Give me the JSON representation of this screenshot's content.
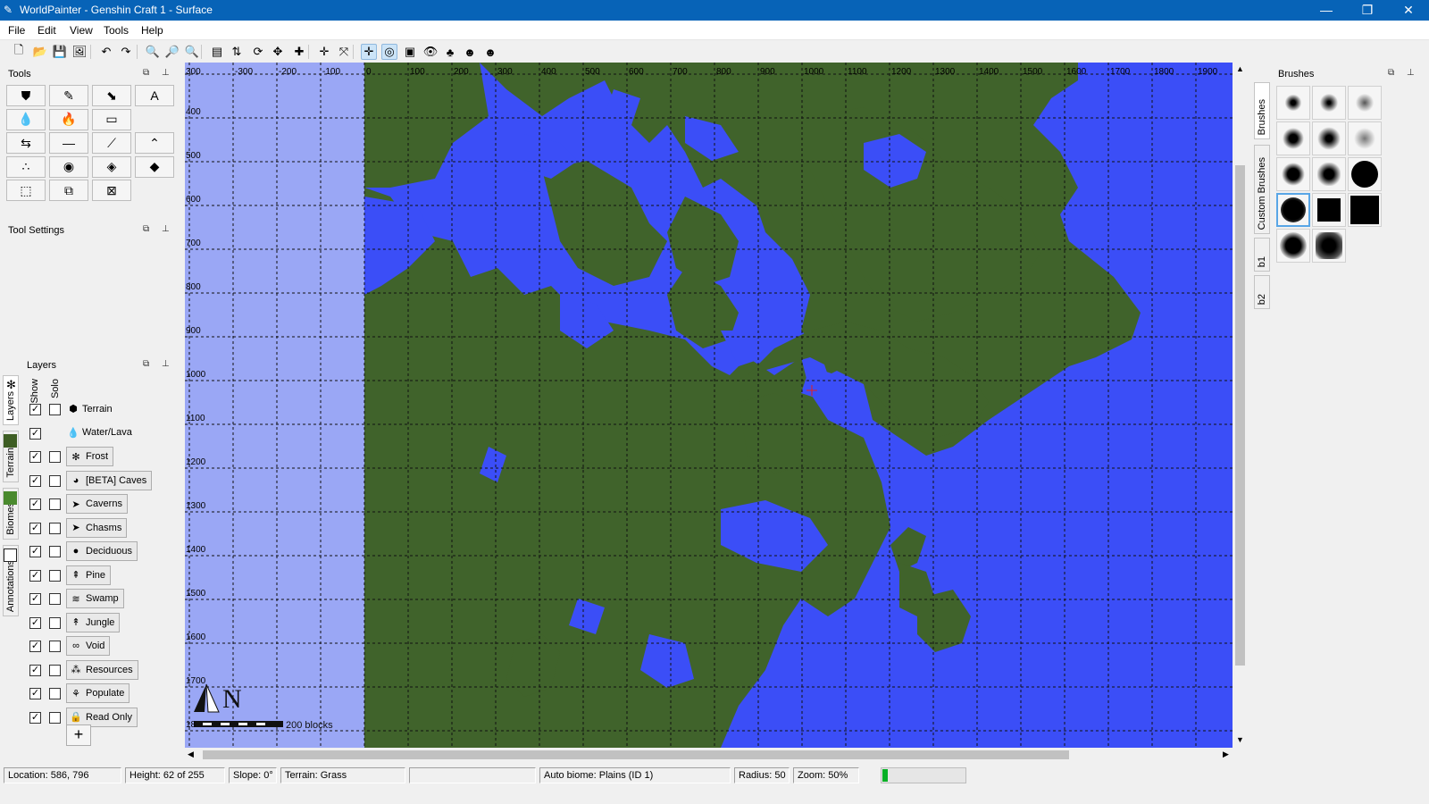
{
  "window": {
    "title": "WorldPainter - Genshin Craft 1 - Surface",
    "min": "—",
    "max": "❐",
    "close": "✕"
  },
  "menu": [
    "File",
    "Edit",
    "View",
    "Tools",
    "Help"
  ],
  "toolbar": [
    {
      "icon": "new-icon",
      "glyph": "🗋"
    },
    {
      "icon": "open-icon",
      "glyph": "📂"
    },
    {
      "icon": "save-icon",
      "glyph": "💾"
    },
    {
      "icon": "export-icon",
      "glyph": "🖼"
    },
    {
      "icon": "undo-icon",
      "glyph": "↶"
    },
    {
      "icon": "redo-icon",
      "glyph": "↷"
    },
    {
      "icon": "zoom-in-icon",
      "glyph": "🔍"
    },
    {
      "icon": "zoom-reset-icon",
      "glyph": "🔎"
    },
    {
      "icon": "zoom-out-icon",
      "glyph": "🔍"
    },
    {
      "icon": "dimension-properties-icon",
      "glyph": "▤"
    },
    {
      "icon": "change-height-icon",
      "glyph": "⇅"
    },
    {
      "icon": "rotate-icon",
      "glyph": "⟳"
    },
    {
      "icon": "shift-icon",
      "glyph": "✥"
    },
    {
      "icon": "add-tiles-icon",
      "glyph": "✚"
    },
    {
      "icon": "remove-tiles-icon",
      "glyph": "✛"
    },
    {
      "icon": "fit-icon",
      "glyph": "⤧"
    },
    {
      "icon": "grid-icon",
      "glyph": "✛"
    },
    {
      "icon": "contours-icon",
      "glyph": "◎"
    },
    {
      "icon": "view-icon",
      "glyph": "▣"
    },
    {
      "icon": "view-3d-icon",
      "glyph": "👁"
    },
    {
      "icon": "biomes-icon",
      "glyph": "♣"
    },
    {
      "icon": "globe-icon",
      "glyph": "☻"
    },
    {
      "icon": "globe-alt-icon",
      "glyph": "☻"
    }
  ],
  "tools_panel": {
    "title": "Tools",
    "tools": [
      {
        "name": "raise-lower-icon",
        "glyph": "⛊"
      },
      {
        "name": "pencil-icon",
        "glyph": "✎"
      },
      {
        "name": "flood-icon",
        "glyph": "⬊"
      },
      {
        "name": "text-icon",
        "glyph": "A"
      },
      {
        "name": "water-icon",
        "glyph": "💧"
      },
      {
        "name": "lava-icon",
        "glyph": "🔥"
      },
      {
        "name": "sponge-icon",
        "glyph": "▭"
      },
      {
        "name": "smooth-icon",
        "glyph": "⇆"
      },
      {
        "name": "flatten-icon",
        "glyph": "—"
      },
      {
        "name": "slope-icon",
        "glyph": "⟋"
      },
      {
        "name": "mountain-icon",
        "glyph": "⌃"
      },
      {
        "name": "spray-icon",
        "glyph": "∴"
      },
      {
        "name": "globe-tool-icon",
        "glyph": "◉"
      },
      {
        "name": "raise-pyramid-icon",
        "glyph": "◈"
      },
      {
        "name": "raise-rotated-pyramid-icon",
        "glyph": "◆"
      },
      {
        "name": "select-icon",
        "glyph": "⬚"
      },
      {
        "name": "copy-selection-icon",
        "glyph": "⧉"
      },
      {
        "name": "clear-selection-icon",
        "glyph": "⊠"
      }
    ]
  },
  "tool_settings": {
    "title": "Tool Settings"
  },
  "layers_panel": {
    "title": "Layers",
    "col_show": "Show",
    "col_solo": "Solo",
    "layers": [
      {
        "label": "Terrain",
        "icon": "terrain-icon",
        "glyph": "⬢",
        "show": true,
        "solo": false,
        "plain": true
      },
      {
        "label": "Water/Lava",
        "icon": "water-lava-icon",
        "glyph": "💧",
        "show": true,
        "solo": null,
        "plain": true
      },
      {
        "label": "Frost",
        "icon": "frost-icon",
        "glyph": "✻",
        "show": true,
        "solo": false
      },
      {
        "label": "[BETA] Caves",
        "icon": "caves-icon",
        "glyph": "◕",
        "show": true,
        "solo": false
      },
      {
        "label": "Caverns",
        "icon": "caverns-icon",
        "glyph": "➤",
        "show": true,
        "solo": false
      },
      {
        "label": "Chasms",
        "icon": "chasms-icon",
        "glyph": "➤",
        "show": true,
        "solo": false
      },
      {
        "label": "Deciduous",
        "icon": "deciduous-icon",
        "glyph": "●",
        "show": true,
        "solo": false
      },
      {
        "label": "Pine",
        "icon": "pine-icon",
        "glyph": "⇞",
        "show": true,
        "solo": false
      },
      {
        "label": "Swamp",
        "icon": "swamp-icon",
        "glyph": "≋",
        "show": true,
        "solo": false
      },
      {
        "label": "Jungle",
        "icon": "jungle-icon",
        "glyph": "↟",
        "show": true,
        "solo": false
      },
      {
        "label": "Void",
        "icon": "void-icon",
        "glyph": "∞",
        "show": true,
        "solo": false
      },
      {
        "label": "Resources",
        "icon": "resources-icon",
        "glyph": "⁂",
        "show": true,
        "solo": false
      },
      {
        "label": "Populate",
        "icon": "populate-icon",
        "glyph": "⚘",
        "show": true,
        "solo": false
      },
      {
        "label": "Read Only",
        "icon": "lock-icon",
        "glyph": "🔒",
        "show": true,
        "solo": false
      }
    ],
    "add_label": "+"
  },
  "left_tabs": [
    "Layers",
    "Terrain",
    "Biomes",
    "Annotations"
  ],
  "right_tabs": [
    "Brushes",
    "Custom Brushes",
    "b1",
    "b2"
  ],
  "brushes_panel": {
    "title": "Brushes"
  },
  "map": {
    "x_ticks": [
      "300",
      "-300",
      "-200",
      "-100",
      "0",
      "100",
      "200",
      "300",
      "400",
      "500",
      "600",
      "700",
      "800",
      "900",
      "1000",
      "1100",
      "1200",
      "1300",
      "1400",
      "1500",
      "1600",
      "1700",
      "1800",
      "1900"
    ],
    "y_ticks": [
      "400",
      "500",
      "600",
      "700",
      "800",
      "900",
      "1000",
      "1100",
      "1200",
      "1300",
      "1400",
      "1500",
      "1600",
      "1700",
      "18"
    ],
    "scale_label": "200 blocks",
    "north_label": "N",
    "colors": {
      "land": "#40632b",
      "water": "#3b4ef7",
      "void": "#9aa7f5"
    }
  },
  "status": {
    "location": "Location: 586, 796",
    "height": "Height: 62 of 255",
    "slope": "Slope: 0°",
    "terrain": "Terrain: Grass",
    "blank": "",
    "biome": "Auto biome: Plains (ID 1)",
    "radius": "Radius: 50",
    "zoom": "Zoom: 50%",
    "progress": 0.06
  }
}
